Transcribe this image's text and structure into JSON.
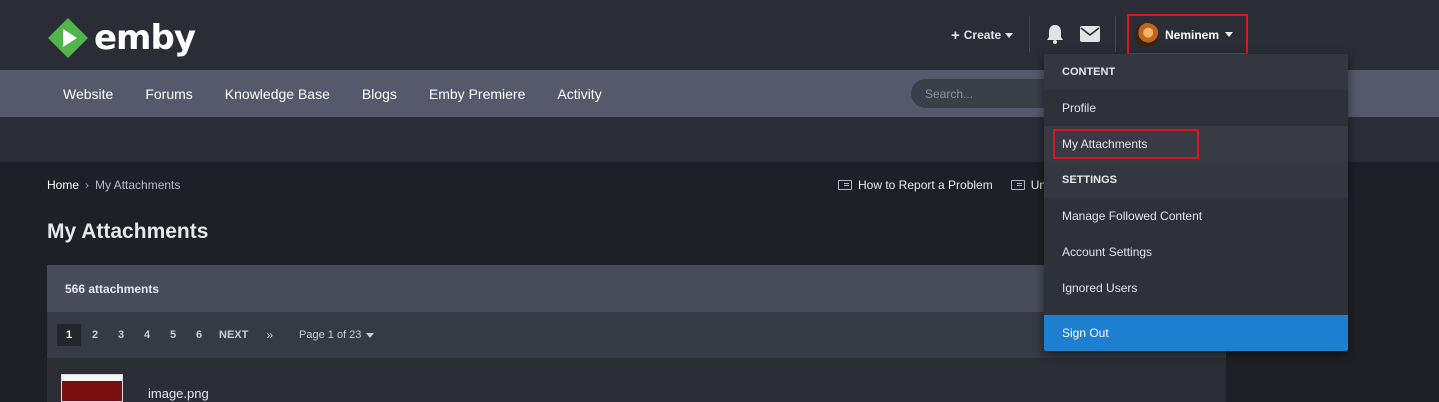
{
  "brand": {
    "logo_text": "emby",
    "accent": "#52b54b"
  },
  "header": {
    "create_label": "Create",
    "user_name": "Neminem",
    "icons": [
      "plus-icon",
      "bell-icon",
      "envelope-icon",
      "caret-down-icon"
    ]
  },
  "nav": {
    "items": [
      "Website",
      "Forums",
      "Knowledge Base",
      "Blogs",
      "Emby Premiere",
      "Activity"
    ],
    "search_placeholder": "Search..."
  },
  "breadcrumb": {
    "home": "Home",
    "current": "My Attachments"
  },
  "help_links": [
    "How to Report a Problem",
    "Un"
  ],
  "page": {
    "title": "My Attachments"
  },
  "attachments": {
    "count_label": "566 attachments",
    "pager": {
      "pages": [
        "1",
        "2",
        "3",
        "4",
        "5",
        "6"
      ],
      "current": "1",
      "next_label": "NEXT",
      "last_label": "»",
      "jump_label": "Page 1 of 23"
    },
    "first_item_name": "image.png"
  },
  "menu": {
    "content_header": "CONTENT",
    "profile": "Profile",
    "my_attachments": "My Attachments",
    "settings_header": "SETTINGS",
    "manage_followed": "Manage Followed Content",
    "account_settings": "Account Settings",
    "ignored_users": "Ignored Users",
    "sign_out": "Sign Out"
  },
  "colors": {
    "highlight_border": "#e2141d",
    "sign_out_bg": "#1c7fcf",
    "header_bg": "#2a2d35",
    "nav_bg": "#545a6c"
  }
}
